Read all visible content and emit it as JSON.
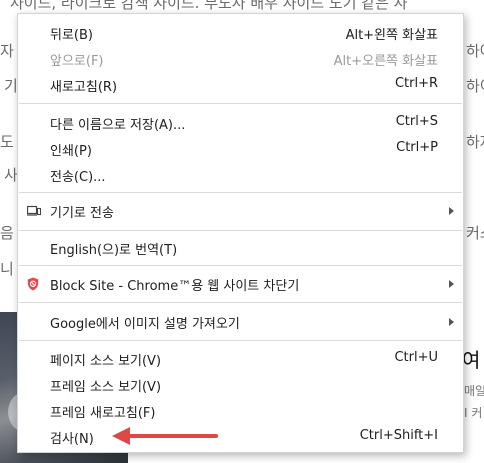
{
  "background": {
    "left_lines": [
      "사",
      "자",
      "기",
      "도",
      "사",
      "음",
      "니"
    ],
    "top_line": "사이드, 라이크로 감색 사이드. 부도사 배우 사이드 도기 같은 사",
    "right_lines": [
      "하여",
      "하이",
      "하자",
      "커스"
    ],
    "right_heading": "여",
    "right_small": [
      "매일",
      "I 커"
    ]
  },
  "menu": {
    "items": [
      {
        "label": "뒤로(B)",
        "shortcut": "Alt+왼쪽 화살표",
        "disabled": false
      },
      {
        "label": "앞으로(F)",
        "shortcut": "Alt+오른쪽 화살표",
        "disabled": true
      },
      {
        "label": "새로고침(R)",
        "shortcut": "Ctrl+R",
        "disabled": false
      },
      {
        "label": "다른 이름으로 저장(A)...",
        "shortcut": "Ctrl+S",
        "disabled": false
      },
      {
        "label": "인쇄(P)",
        "shortcut": "Ctrl+P",
        "disabled": false
      },
      {
        "label": "전송(C)...",
        "shortcut": "",
        "disabled": false
      },
      {
        "label": "기기로 전송",
        "shortcut": "",
        "submenu": true,
        "icon": "device-icon"
      },
      {
        "label": "English(으)로 번역(T)",
        "shortcut": ""
      },
      {
        "label": "Block Site - Chrome™용 웹 사이트 차단기",
        "shortcut": "",
        "submenu": true,
        "icon": "block-site-shield-icon"
      },
      {
        "label": "Google에서 이미지 설명 가져오기",
        "shortcut": "",
        "submenu": true
      },
      {
        "label": "페이지 소스 보기(V)",
        "shortcut": "Ctrl+U"
      },
      {
        "label": "프레임 소스 보기(V)",
        "shortcut": ""
      },
      {
        "label": "프레임 새로고침(F)",
        "shortcut": ""
      },
      {
        "label": "검사(N)",
        "shortcut": "Ctrl+Shift+I"
      }
    ]
  },
  "colors": {
    "annotation_arrow": "#e04848",
    "block_site_icon": "#e5484d"
  }
}
